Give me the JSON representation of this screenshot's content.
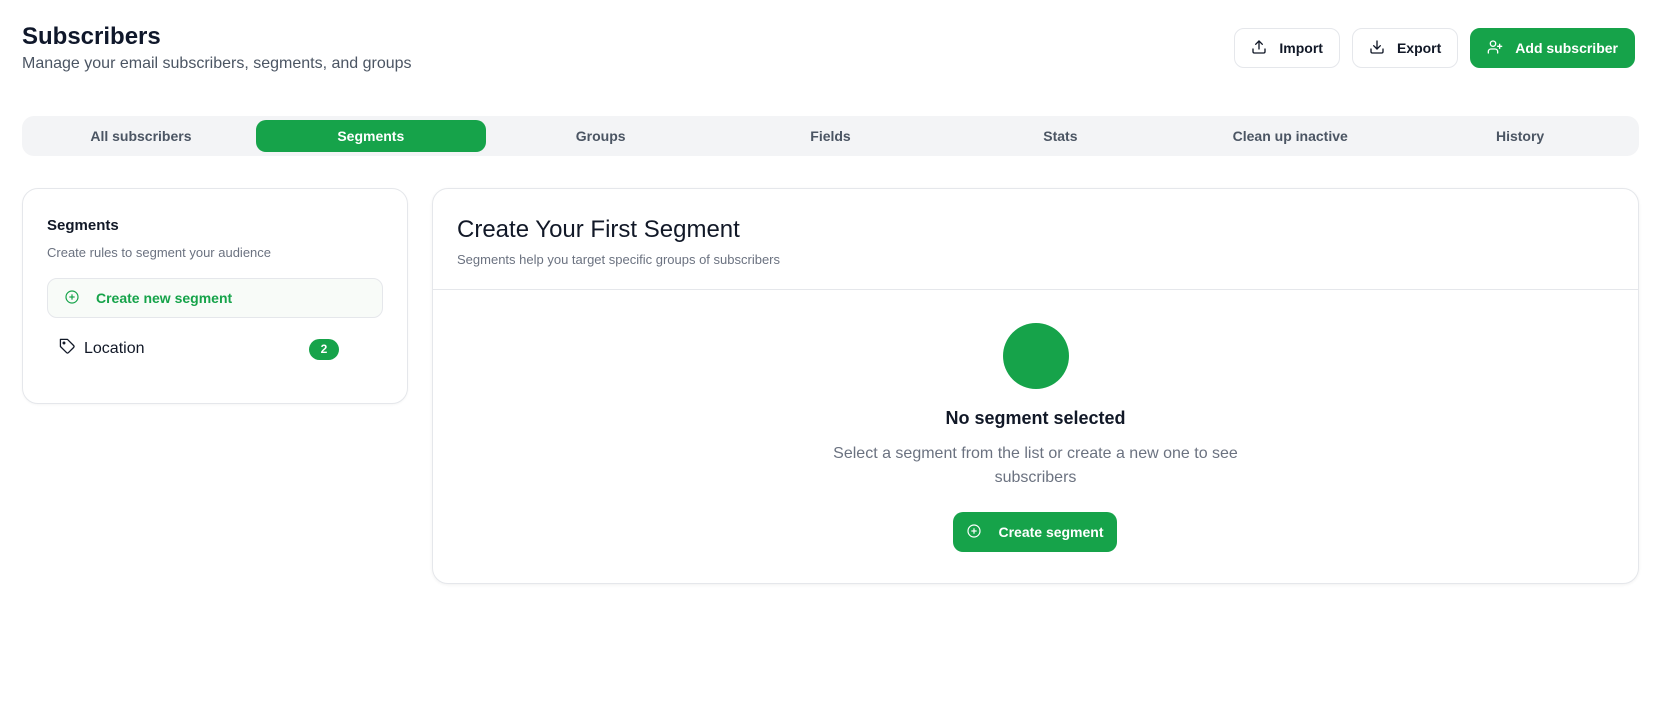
{
  "header": {
    "title": "Subscribers",
    "subtitle": "Manage your email subscribers, segments, and groups",
    "import_label": "Import",
    "export_label": "Export",
    "add_label": "Add subscriber"
  },
  "tabs": [
    {
      "label": "All subscribers"
    },
    {
      "label": "Segments",
      "active": true
    },
    {
      "label": "Groups"
    },
    {
      "label": "Fields"
    },
    {
      "label": "Stats"
    },
    {
      "label": "Clean up inactive"
    },
    {
      "label": "History"
    }
  ],
  "sidebar": {
    "title": "Segments",
    "subtitle": "Create rules to segment your audience",
    "create_label": "Create new segment",
    "items": [
      {
        "label": "Location",
        "count": "2"
      }
    ]
  },
  "main": {
    "title": "Create Your First Segment",
    "subtitle": "Segments help you target specific groups of subscribers",
    "empty_title": "No segment selected",
    "empty_text": "Select a segment from the list or create a new one to see subscribers",
    "cta_label": "Create segment"
  },
  "icons": {
    "import": "upload-icon",
    "export": "download-icon",
    "add": "user-plus-icon",
    "create": "plus-circle-icon",
    "segment": "tag-icon"
  },
  "colors": {
    "accent": "#16a34a",
    "tab_bg": "#f3f4f6",
    "border": "#e5e7eb",
    "muted_text": "#6b7280"
  }
}
